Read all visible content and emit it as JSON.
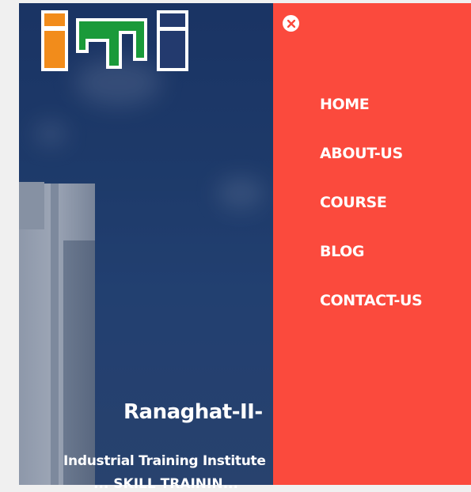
{
  "logo": {
    "text": "ITI",
    "colors": [
      "#f28c1b",
      "#1a9a3a",
      "#233a6e"
    ]
  },
  "hero": {
    "title": "Ranaghat-II-",
    "subtitle": "Industrial Training Institute",
    "tagline": "... SKILL TRAININ..."
  },
  "menu": {
    "close_icon": "close-icon",
    "items": [
      {
        "label": "HOME"
      },
      {
        "label": "ABOUT-US"
      },
      {
        "label": "COURSE"
      },
      {
        "label": "BLOG"
      },
      {
        "label": "CONTACT-US"
      }
    ]
  },
  "colors": {
    "menu_background": "#fb4a3d",
    "menu_text": "#ffffff",
    "hero_overlay": "#1e3a6e"
  }
}
